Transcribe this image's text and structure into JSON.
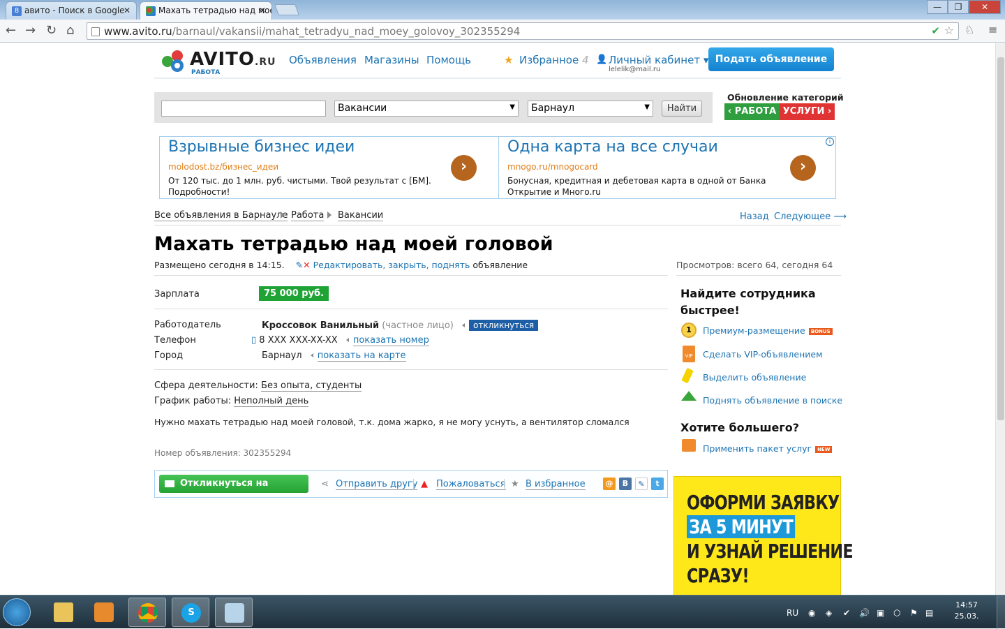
{
  "browser": {
    "tabs": [
      {
        "title": "авито - Поиск в Google"
      },
      {
        "title": "Махать тетрадью над мое"
      }
    ],
    "url_host": "www.avito.ru",
    "url_path": "/barnaul/vakansii/mahat_tetradyu_nad_moey_golovoy_302355294"
  },
  "header": {
    "logo": "AVITO",
    "logo_ru": ".RU",
    "logo_sub": "РАБОТА",
    "nav": [
      "Объявления",
      "Магазины",
      "Помощь"
    ],
    "favorites_label": "Избранное",
    "favorites_count": "4",
    "cabinet_label": "Личный кабинет ▾",
    "cabinet_email": "lelelik@mail.ru",
    "post_button": "Подать объявление"
  },
  "search": {
    "query": "",
    "category": "Вакансии",
    "city": "Барнаул",
    "button": "Найти"
  },
  "category_update": {
    "title": "Обновление категорий",
    "work": "‹ РАБОТА",
    "services": "УСЛУГИ ›"
  },
  "ads": [
    {
      "title": "Взрывные бизнес идеи",
      "url": "molodost.bz/бизнес_идеи",
      "text": "От 120 тыс. до 1 млн. руб. чистыми. Твой результат с [БМ]. Подробности!"
    },
    {
      "title": "Одна карта на все случаи",
      "url": "mnogo.ru/mnogocard",
      "text": "Бонусная, кредитная и дебетовая карта в одной от Банка Открытие и Много.ru"
    }
  ],
  "breadcrumbs": [
    "Все объявления в Барнауле",
    "Работа",
    "Вакансии"
  ],
  "pagenav": {
    "back": "Назад",
    "next": "Следующее ⟶"
  },
  "listing": {
    "title": "Махать тетрадью над моей головой",
    "posted": "Размещено сегодня в 14:15.",
    "edit_link": "Редактировать, закрыть, поднять",
    "edit_suffix": "объявление",
    "views": "Просмотров: всего 64, сегодня 64",
    "salary_label": "Зарплата",
    "salary": "75 000 руб.",
    "employer_label": "Работодатель",
    "employer": "Кроссовок Ванильный",
    "employer_type": "(частное лицо)",
    "respond_badge": "откликнуться",
    "phone_label": "Телефон",
    "phone": "8 XXX XXX-XX-XX",
    "show_phone": "показать номер",
    "city_label": "Город",
    "city": "Барнаул",
    "show_map": "показать на карте",
    "sphere_label": "Сфера деятельности:",
    "sphere": "Без опыта, студенты",
    "schedule_label": "График работы:",
    "schedule": "Неполный день",
    "description": "Нужно махать тетрадью над моей головой, т.к. дома жарко, я не могу уснуть, а вентилятор сломался",
    "ad_number": "Номер объявления: 302355294"
  },
  "actions": {
    "respond": "Откликнуться на вакансию",
    "send": "Отправить другу",
    "complain": "Пожаловаться",
    "favorite": "В избранное"
  },
  "sidebar": {
    "heading": "Найдите сотрудника быстрее!",
    "services": [
      {
        "label": "Премиум-размещение",
        "tag": "BONUS"
      },
      {
        "label": "Сделать VIP-объявлением",
        "tag": ""
      },
      {
        "label": "Выделить объявление",
        "tag": ""
      },
      {
        "label": "Поднять объявление в поиске",
        "tag": ""
      }
    ],
    "heading2": "Хотите большего?",
    "package": "Применить пакет услуг",
    "package_tag": "NEW"
  },
  "banner": {
    "line1": "ОФОРМИ ЗАЯВКУ",
    "line2": "ЗА 5 МИНУТ",
    "line3": "И УЗНАЙ РЕШЕНИЕ",
    "line4": "СРАЗУ!"
  },
  "taskbar": {
    "lang": "RU",
    "time": "14:57",
    "date": "25.03."
  },
  "colors": {
    "brand_blue": "#1d74b3",
    "post_button": "#1482cf",
    "salary_green": "#1fa335",
    "banner_yellow": "#ffe81a"
  }
}
